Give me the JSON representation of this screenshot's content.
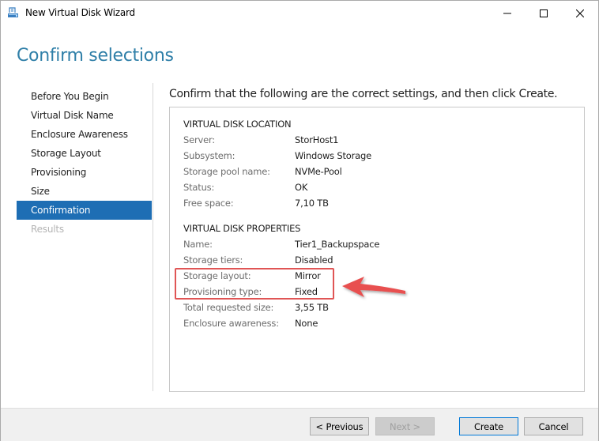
{
  "window": {
    "title": "New Virtual Disk Wizard"
  },
  "page": {
    "heading": "Confirm selections",
    "instruction": "Confirm that the following are the correct settings, and then click Create."
  },
  "nav": {
    "items": [
      {
        "label": "Before You Begin",
        "state": "normal"
      },
      {
        "label": "Virtual Disk Name",
        "state": "normal"
      },
      {
        "label": "Enclosure Awareness",
        "state": "normal"
      },
      {
        "label": "Storage Layout",
        "state": "normal"
      },
      {
        "label": "Provisioning",
        "state": "normal"
      },
      {
        "label": "Size",
        "state": "normal"
      },
      {
        "label": "Confirmation",
        "state": "active"
      },
      {
        "label": "Results",
        "state": "disabled"
      }
    ]
  },
  "location": {
    "title": "VIRTUAL DISK LOCATION",
    "rows": [
      {
        "label": "Server:",
        "value": "StorHost1"
      },
      {
        "label": "Subsystem:",
        "value": "Windows Storage"
      },
      {
        "label": "Storage pool name:",
        "value": "NVMe-Pool"
      },
      {
        "label": "Status:",
        "value": "OK"
      },
      {
        "label": "Free space:",
        "value": "7,10 TB"
      }
    ]
  },
  "properties": {
    "title": "VIRTUAL DISK PROPERTIES",
    "rows": [
      {
        "label": "Name:",
        "value": "Tier1_Backupspace"
      },
      {
        "label": "Storage tiers:",
        "value": "Disabled"
      },
      {
        "label": "Storage layout:",
        "value": "Mirror"
      },
      {
        "label": "Provisioning type:",
        "value": "Fixed"
      },
      {
        "label": "Total requested size:",
        "value": "3,55 TB"
      },
      {
        "label": "Enclosure awareness:",
        "value": "None"
      }
    ]
  },
  "buttons": {
    "previous": "< Previous",
    "next": "Next >",
    "create": "Create",
    "cancel": "Cancel"
  },
  "colors": {
    "accent": "#2f7fa8",
    "nav_active": "#1e6eb4",
    "annotation": "#e05555"
  }
}
